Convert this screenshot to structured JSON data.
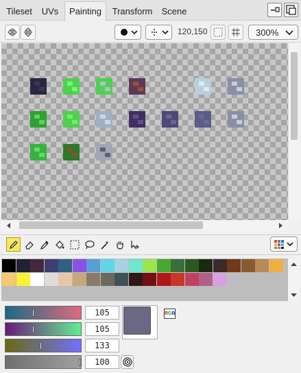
{
  "tabs": [
    {
      "label": "Tileset"
    },
    {
      "label": "UVs"
    },
    {
      "label": "Painting"
    },
    {
      "label": "Transform"
    },
    {
      "label": "Scene"
    }
  ],
  "toolbar": {
    "coords": "120,150",
    "zoom": "300%"
  },
  "tiles": [
    {
      "color": "#2a2840",
      "accent": "#3a3755"
    },
    {
      "color": "#4fd050",
      "accent": "#6aff6a"
    },
    {
      "color": "#4fd050",
      "accent": "#b0c0c8"
    },
    {
      "color": "#5a3a5a",
      "accent": "#a05030"
    },
    {
      "color": "#b8d0dc",
      "accent": "#d8ecf4"
    },
    {
      "color": "#8890a8",
      "accent": "#c8ccd8"
    },
    {
      "color": "#30a030",
      "accent": "#60d060"
    },
    {
      "color": "#4fd050",
      "accent": "#70ee70"
    },
    {
      "color": "#a0b0c0",
      "accent": "#c8d8e4"
    },
    {
      "color": "#403060",
      "accent": "#605090"
    },
    {
      "color": "#4e4878",
      "accent": "#6a6498"
    },
    {
      "color": "#5c5c88",
      "accent": "#6a6a96"
    },
    {
      "color": "#8890a8",
      "accent": "#c8ccd8"
    },
    {
      "color": "#3ab040",
      "accent": "#5ae060"
    },
    {
      "color": "#2a7a2a",
      "accent": "#8a5030"
    },
    {
      "color": "#a0a8b8",
      "accent": "#6a5a70"
    }
  ],
  "palette": [
    "#000000",
    "#222034",
    "#45283c",
    "#3f3f74",
    "#306082",
    "#8a52e6",
    "#5b9ed6",
    "#5fd6e6",
    "#a8d0e0",
    "#6fe6d0",
    "#99e550",
    "#4aa832",
    "#3b6e3b",
    "#2a5a20",
    "#1a2a10",
    "#3a2a2a",
    "#6e3a1a",
    "#8a5a30",
    "#b88a5a",
    "#f0b040",
    "#f7c870",
    "#fbf236",
    "#ffffff",
    "#e0dcd8",
    "#e6c8a8",
    "#c8a878",
    "#8a7a6a",
    "#6a6a60",
    "#405058",
    "#301818",
    "#701010",
    "#b01818",
    "#c83828",
    "#c04060",
    "#b06088",
    "#d8a0e0"
  ],
  "sliders": [
    {
      "value": "105"
    },
    {
      "value": "105"
    },
    {
      "value": "133"
    },
    {
      "value": "100"
    }
  ],
  "preview": {
    "color": "#696985",
    "mode": "RGB"
  },
  "colors": {
    "accent": "#f5e76a",
    "canvas_light": "#c8c8c8",
    "canvas_dark": "#a6a6a6"
  }
}
